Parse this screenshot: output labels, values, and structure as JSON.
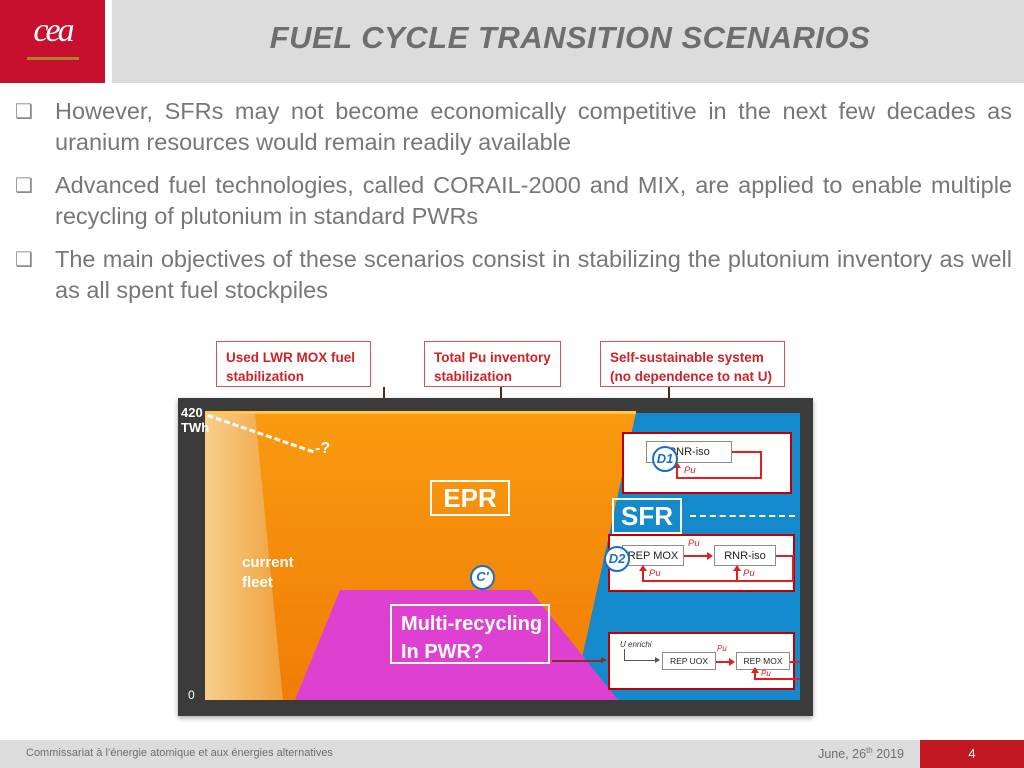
{
  "header": {
    "logo_text": "cea",
    "title": "FUEL CYCLE TRANSITION SCENARIOS",
    "brand_red": "#c8102e",
    "band_gray": "#dcdcdc",
    "title_gray": "#6e6e6e"
  },
  "bullets": [
    {
      "marker": "❑",
      "text": "However, SFRs may not become economically competitive in the next few decades as uranium resources would remain readily available"
    },
    {
      "marker": "❑",
      "text": "Advanced fuel technologies, called CORAIL-2000 and MIX, are applied to enable multiple recycling of plutonium in standard PWRs"
    },
    {
      "marker": "❑",
      "text": "The main objectives of these scenarios consist in stabilizing the plutonium inventory as well as all spent fuel stockpiles"
    }
  ],
  "callouts": [
    {
      "line1": "Used LWR MOX fuel",
      "line2": "stabilization"
    },
    {
      "line1": "Total Pu inventory",
      "line2": "stabilization"
    },
    {
      "line1": "Self-sustainable system",
      "line2": "(no dependence to nat U)"
    }
  ],
  "figure": {
    "axis_top_line1": "420",
    "axis_top_line2": "TWh",
    "axis_zero": "0",
    "trend_marker": "-?",
    "fleet_line1": "current",
    "fleet_line2": "fleet",
    "label_epr": "EPR",
    "label_sfr": "SFR",
    "label_multi_line1": "Multi-recycling",
    "label_multi_line2": "In PWR?",
    "badge_d1": "D1",
    "badge_d2": "D2",
    "badge_cprime": "C'",
    "colors": {
      "frame": "#3b3b3b",
      "current_fleet": "#F3B457",
      "epr_orange": "#F7910C",
      "sfr_blue": "#1489CB",
      "pwr_magenta": "#DE41D2",
      "red_flow": "#e02020",
      "badge_blue": "#1a6fc4"
    },
    "panel_d1": {
      "boxes": [
        "RNR-iso"
      ],
      "flows": [
        "Pu"
      ]
    },
    "panel_d2": {
      "boxes": [
        "REP MOX",
        "RNR-iso"
      ],
      "flows": [
        "Pu",
        "Pu",
        "Pu"
      ]
    },
    "panel_c": {
      "feed_label": "U enrichi",
      "boxes": [
        "REP UOX",
        "REP MOX"
      ],
      "flows": [
        "Pu",
        "Pu"
      ]
    }
  },
  "footer": {
    "organization": "Commissariat à l’énergie atomique et aux énergies alternatives",
    "date_main": "June, 26",
    "date_sup": "th",
    "date_year": " 2019",
    "page_number": "4",
    "page_block_color": "#c01722"
  }
}
